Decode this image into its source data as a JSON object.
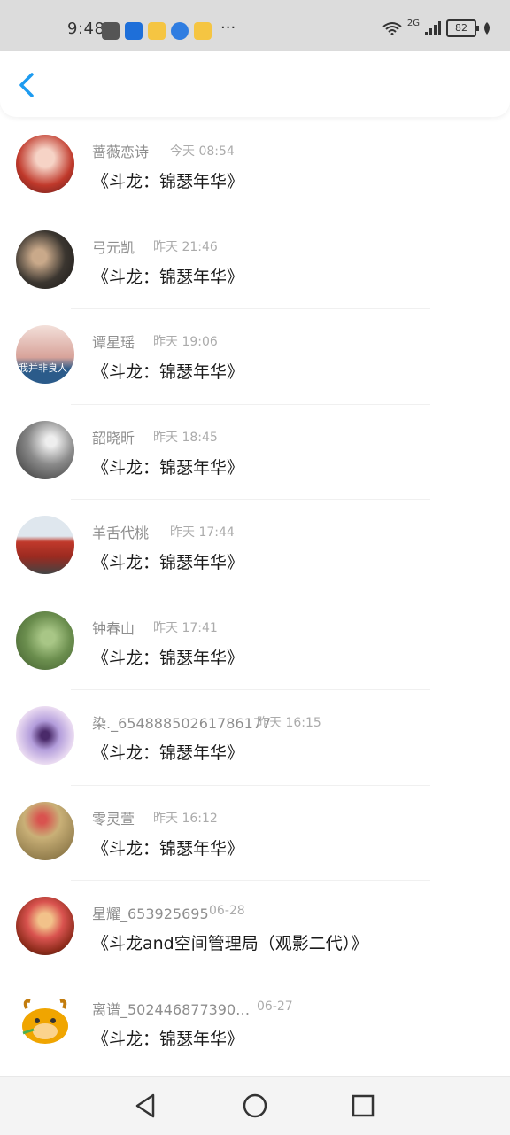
{
  "status_bar": {
    "time": "9:48",
    "battery": "82",
    "network": "2G",
    "more": "···"
  },
  "header": {
    "back_icon": "chevron-left-icon",
    "accent_color": "#1d9bf0"
  },
  "messages": [
    {
      "name": "蔷薇恋诗",
      "time": "今天 08:54",
      "title": "《斗龙：锦瑟年华》",
      "avatar_color": "#c0392b"
    },
    {
      "name": "弓元凯",
      "time": "昨天 21:46",
      "title": "《斗龙：锦瑟年华》",
      "avatar_color": "#3b3630"
    },
    {
      "name": "谭星瑶",
      "time": "昨天 19:06",
      "title": "《斗龙：锦瑟年华》",
      "avatar_color": "#d8a39a",
      "avatar_text": "我并非良人"
    },
    {
      "name": "韶晓昕",
      "time": "昨天 18:45",
      "title": "《斗龙：锦瑟年华》",
      "avatar_color": "#777777"
    },
    {
      "name": "羊舌代桃",
      "time": "昨天 17:44",
      "title": "《斗龙：锦瑟年华》",
      "avatar_color": "#c0392b"
    },
    {
      "name": "钟春山",
      "time": "昨天 17:41",
      "title": "《斗龙：锦瑟年华》",
      "avatar_color": "#6b8e4e"
    },
    {
      "name": "染._65488850261786177",
      "time": "昨天 16:15",
      "title": "《斗龙：锦瑟年华》",
      "avatar_color": "#b39ddb"
    },
    {
      "name": "零灵萱",
      "time": "昨天 16:12",
      "title": "《斗龙：锦瑟年华》",
      "avatar_color": "#c9b077"
    },
    {
      "name": "星耀_653925695",
      "time": "06-28",
      "title": "《斗龙and空间管理局（观影二代）》",
      "avatar_color": "#8d2b1b"
    },
    {
      "name": "离谱_502446877390…",
      "time": "06-27",
      "title": "《斗龙：锦瑟年华》",
      "avatar_color": "#f0a500"
    }
  ],
  "nav": {
    "back_icon": "triangle-back-icon",
    "home_icon": "circle-home-icon",
    "recents_icon": "square-recents-icon"
  }
}
